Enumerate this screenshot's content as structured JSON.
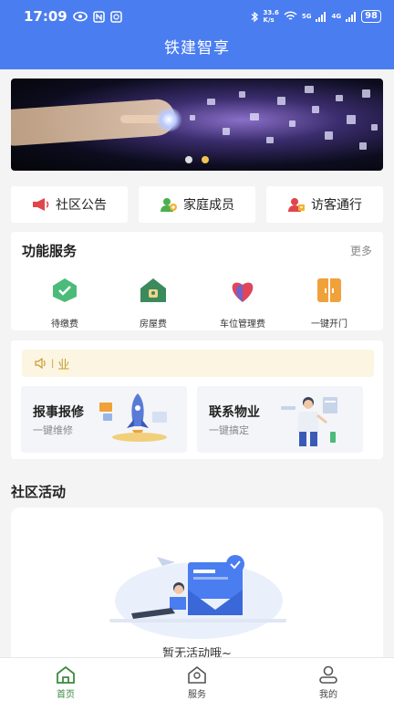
{
  "status_bar": {
    "time": "17:09",
    "network_speed_top": "33.6",
    "network_speed_bottom": "K/s",
    "signal1": "5G",
    "signal2": "4G",
    "battery": "98"
  },
  "header": {
    "title": "铁建智享"
  },
  "banner": {
    "slide_count": 2,
    "active_slide": 2
  },
  "quick_actions": [
    {
      "label": "社区公告",
      "icon": "megaphone-icon"
    },
    {
      "label": "家庭成员",
      "icon": "family-member-icon"
    },
    {
      "label": "访客通行",
      "icon": "visitor-pass-icon"
    }
  ],
  "function_services": {
    "title": "功能服务",
    "more": "更多",
    "items": [
      {
        "label": "待缴费",
        "icon": "check-shield-icon"
      },
      {
        "label": "房屋费",
        "icon": "house-icon"
      },
      {
        "label": "车位管理费",
        "icon": "heart-icon"
      },
      {
        "label": "一键开门",
        "icon": "door-icon"
      }
    ]
  },
  "notice": {
    "text": "业",
    "partial_glyph": "|"
  },
  "service_cards": [
    {
      "title": "报事报修",
      "subtitle": "一键维修",
      "illustration": "rocket-illustration"
    },
    {
      "title": "联系物业",
      "subtitle": "一键搞定",
      "illustration": "person-illustration"
    }
  ],
  "community_activity": {
    "title": "社区活动",
    "empty_text": "暂无活动哦~"
  },
  "tabbar": [
    {
      "label": "首页",
      "icon": "home-icon",
      "active": true
    },
    {
      "label": "服务",
      "icon": "service-icon",
      "active": false
    },
    {
      "label": "我的",
      "icon": "profile-icon",
      "active": false
    }
  ],
  "colors": {
    "header_blue": "#4a7df0",
    "accent_green": "#3b8a3e",
    "notice_bg": "#fbf5e2",
    "notice_text": "#c99a2a",
    "banner_dot_active": "#f3c451"
  }
}
